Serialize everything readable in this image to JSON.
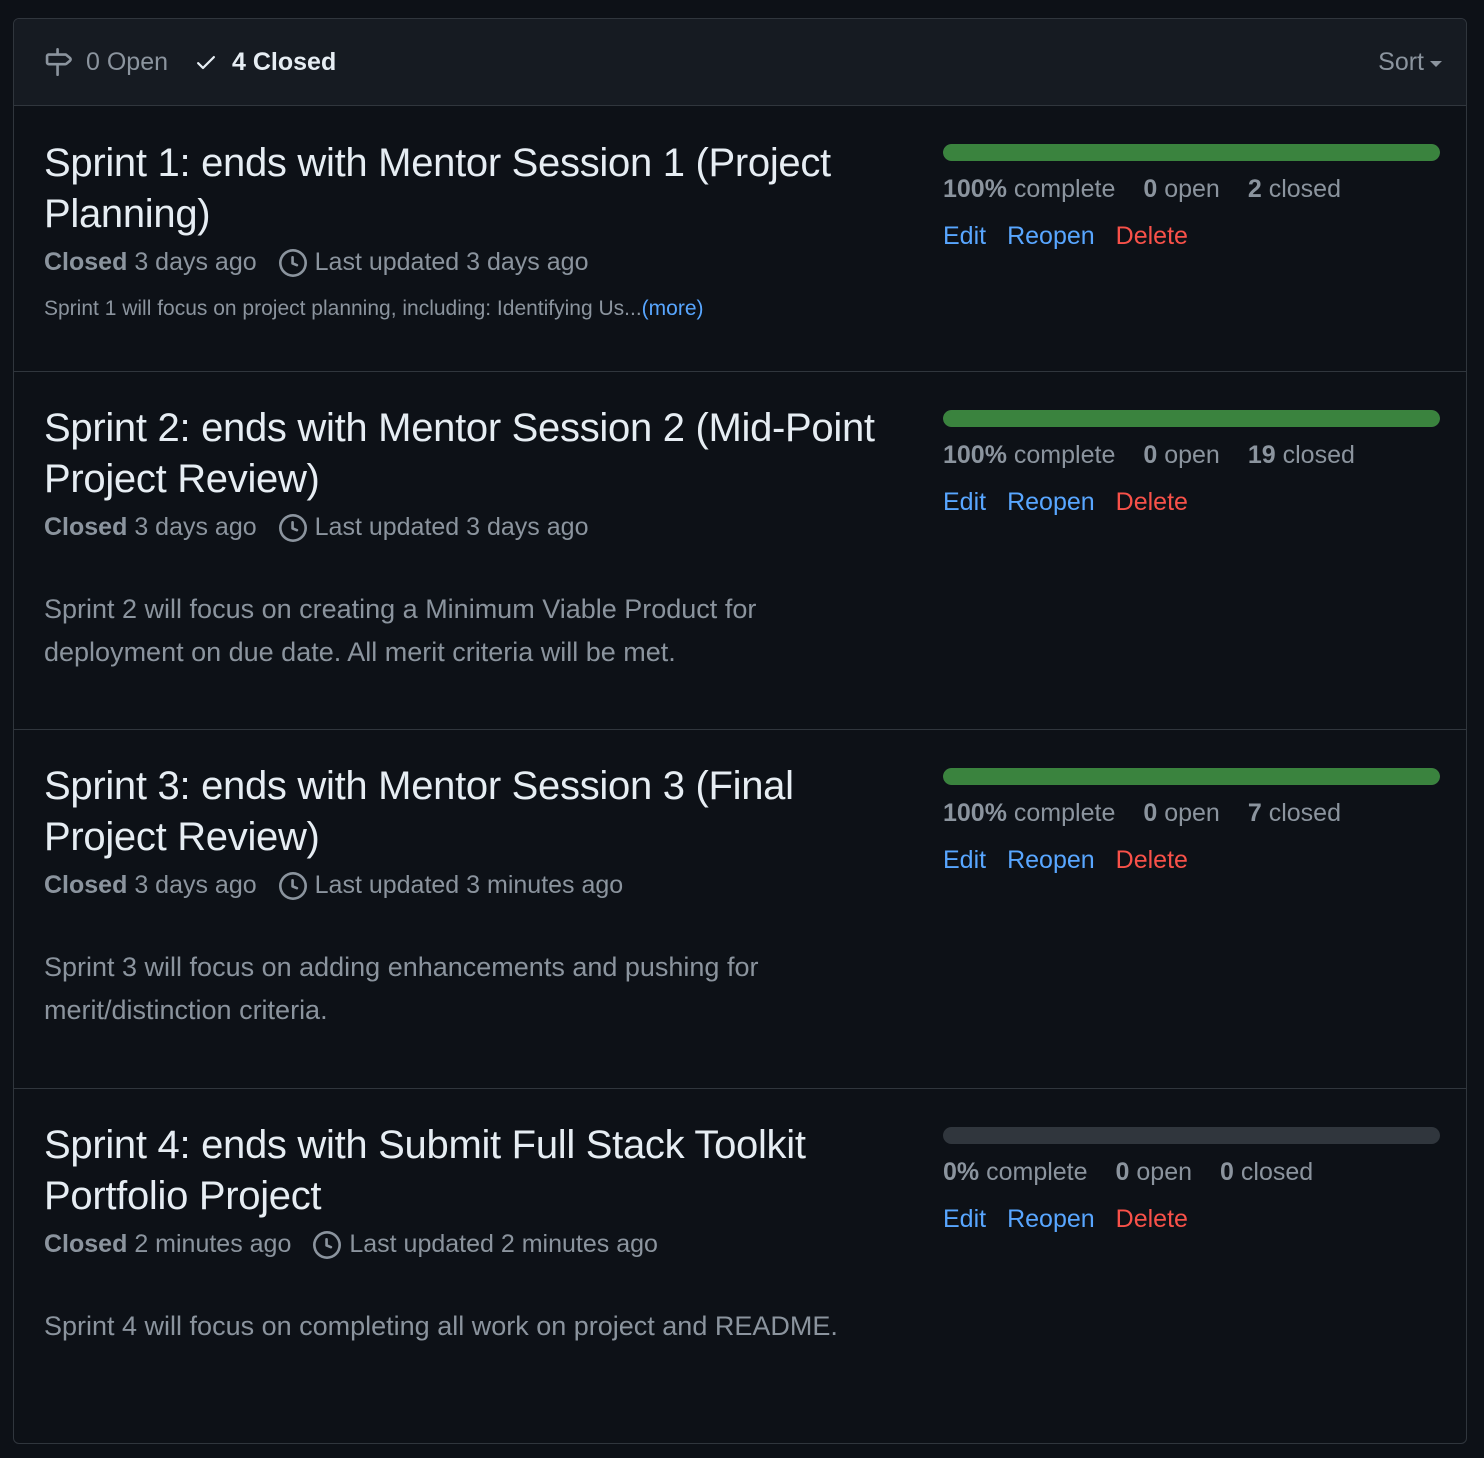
{
  "header": {
    "open_label": "0 Open",
    "closed_label": "4 Closed",
    "sort_label": "Sort"
  },
  "milestones": [
    {
      "title": "Sprint 1: ends with Mentor Session 1 (Project Planning)",
      "closed_label": "Closed",
      "closed_time": "3 days ago",
      "updated": "Last updated 3 days ago",
      "description": "Sprint 1 will focus on project planning, including: Identifying Us...",
      "more_label": "(more)",
      "progress": 100,
      "percent_label": "100%",
      "complete_label": "complete",
      "open_count": "0",
      "open_label": "open",
      "closed_count": "2",
      "closed_count_label": "closed",
      "edit": "Edit",
      "reopen": "Reopen",
      "delete": "Delete"
    },
    {
      "title": "Sprint 2: ends with Mentor Session 2 (Mid-Point Project Review)",
      "closed_label": "Closed",
      "closed_time": "3 days ago",
      "updated": "Last updated 3 days ago",
      "description": "Sprint 2 will focus on creating a Minimum Viable Product for deployment on due date. All merit criteria will be met.",
      "progress": 100,
      "percent_label": "100%",
      "complete_label": "complete",
      "open_count": "0",
      "open_label": "open",
      "closed_count": "19",
      "closed_count_label": "closed",
      "edit": "Edit",
      "reopen": "Reopen",
      "delete": "Delete"
    },
    {
      "title": "Sprint 3: ends with Mentor Session 3 (Final Project Review)",
      "closed_label": "Closed",
      "closed_time": "3 days ago",
      "updated": "Last updated 3 minutes ago",
      "description": "Sprint 3 will focus on adding enhancements and pushing for merit/distinction criteria.",
      "progress": 100,
      "percent_label": "100%",
      "complete_label": "complete",
      "open_count": "0",
      "open_label": "open",
      "closed_count": "7",
      "closed_count_label": "closed",
      "edit": "Edit",
      "reopen": "Reopen",
      "delete": "Delete"
    },
    {
      "title": "Sprint 4: ends with Submit Full Stack Toolkit Portfolio Project",
      "closed_label": "Closed",
      "closed_time": "2 minutes ago",
      "updated": "Last updated 2 minutes ago",
      "description": "Sprint 4 will focus on completing all work on project and README.",
      "progress": 0,
      "percent_label": "0%",
      "complete_label": "complete",
      "open_count": "0",
      "open_label": "open",
      "closed_count": "0",
      "closed_count_label": "closed",
      "edit": "Edit",
      "reopen": "Reopen",
      "delete": "Delete"
    }
  ],
  "colors": {
    "progress_fill": "#3a833e",
    "link": "#58a6ff",
    "danger": "#f85149"
  }
}
